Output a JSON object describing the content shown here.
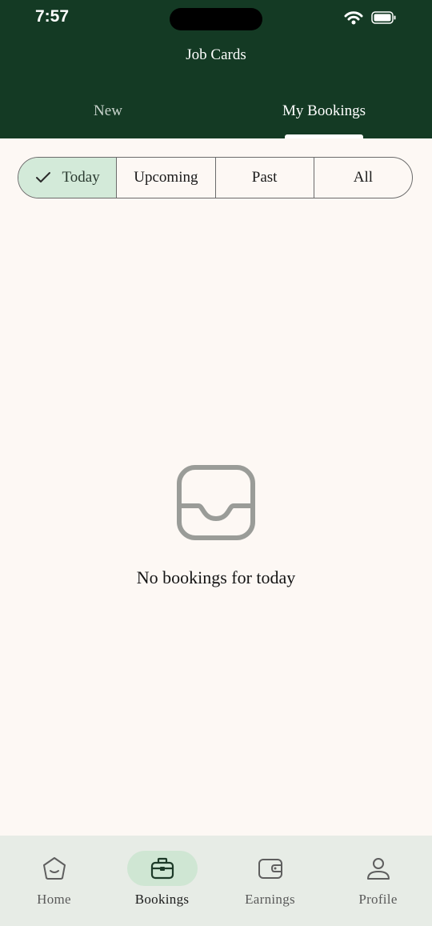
{
  "status_bar": {
    "time": "7:57"
  },
  "header": {
    "title": "Job Cards",
    "tabs": [
      {
        "label": "New",
        "active": false
      },
      {
        "label": "My Bookings",
        "active": true
      }
    ]
  },
  "filter": {
    "segments": [
      {
        "label": "Today",
        "selected": true
      },
      {
        "label": "Upcoming",
        "selected": false
      },
      {
        "label": "Past",
        "selected": false
      },
      {
        "label": "All",
        "selected": false
      }
    ]
  },
  "empty_state": {
    "icon": "inbox-icon",
    "message": "No bookings for today"
  },
  "bottom_nav": {
    "items": [
      {
        "label": "Home",
        "icon": "home-icon",
        "active": false
      },
      {
        "label": "Bookings",
        "icon": "briefcase-icon",
        "active": true
      },
      {
        "label": "Earnings",
        "icon": "wallet-icon",
        "active": false
      },
      {
        "label": "Profile",
        "icon": "person-icon",
        "active": false
      }
    ]
  },
  "colors": {
    "header": "#143a24",
    "background": "#fdf8f4",
    "accent_light": "#d3ead9",
    "nav_bg": "#e7ece6"
  }
}
